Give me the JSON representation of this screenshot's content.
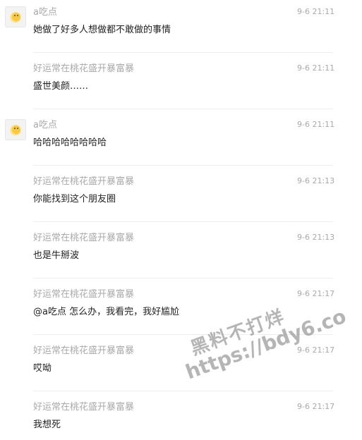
{
  "comments": [
    {
      "nick": "a吃点",
      "time": "9-6 21:11",
      "text": "她做了好多人想做都不敢做的事情",
      "has_avatar": true
    },
    {
      "nick": "好运常在桃花盛开暴富暴",
      "time": "9-6 21:11",
      "text": "盛世美颜……",
      "has_avatar": false
    },
    {
      "nick": "a吃点",
      "time": "9-6 21:11",
      "text": "哈哈哈哈哈哈哈哈",
      "has_avatar": true
    },
    {
      "nick": "好运常在桃花盛开暴富暴",
      "time": "9-6 21:13",
      "text": "你能找到这个朋友圈",
      "has_avatar": false
    },
    {
      "nick": "好运常在桃花盛开暴富暴",
      "time": "9-6 21:13",
      "text": "也是牛掰波",
      "has_avatar": false
    },
    {
      "nick": "好运常在桃花盛开暴富暴",
      "time": "9-6 21:17",
      "text": "@a吃点 怎么办，我看完，我好尴尬",
      "has_avatar": false
    },
    {
      "nick": "好运常在桃花盛开暴富暴",
      "time": "9-6 21:17",
      "text": "哎呦",
      "has_avatar": false
    },
    {
      "nick": "好运常在桃花盛开暴富暴",
      "time": "9-6 21:17",
      "text": "我想死",
      "has_avatar": false
    }
  ],
  "watermark": {
    "line1": "黑料不打烊",
    "line2": "https://bdy6.co"
  }
}
